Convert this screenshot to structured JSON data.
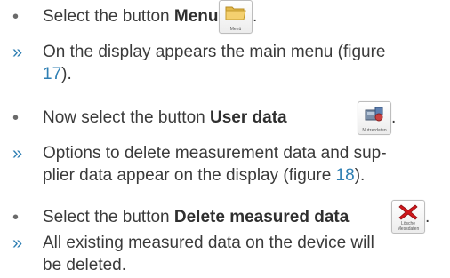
{
  "steps": [
    {
      "marker": "•",
      "pre": "Select the button ",
      "bold": "Menu",
      "post": ".",
      "icon_caption": "Menü",
      "icon": "folder-icon"
    },
    {
      "marker": "»",
      "line1": "On the display appears the main menu (figure",
      "ref": "17",
      "line2_post": ")."
    },
    {
      "marker": "•",
      "pre": "Now select the button ",
      "bold": "User data",
      "post": ".",
      "icon_caption": "Nutzerdaten",
      "icon": "user-data-icon"
    },
    {
      "marker": "»",
      "line1": "Options to delete measurement data and sup-",
      "line2_pre": "plier data appear on the display (figure ",
      "ref": "18",
      "line2_post": ")."
    },
    {
      "marker": "•",
      "pre": "Select the button ",
      "bold": "Delete measured data",
      "post": ".",
      "icon_caption": "Lösche Messdaten",
      "icon": "delete-x-icon"
    },
    {
      "marker": "»",
      "line1": "All existing measured data on the device will",
      "line2": "be deleted."
    }
  ],
  "colors": {
    "text": "#3a3a3a",
    "accent": "#2f7fb3",
    "delete_red": "#d0161b"
  }
}
